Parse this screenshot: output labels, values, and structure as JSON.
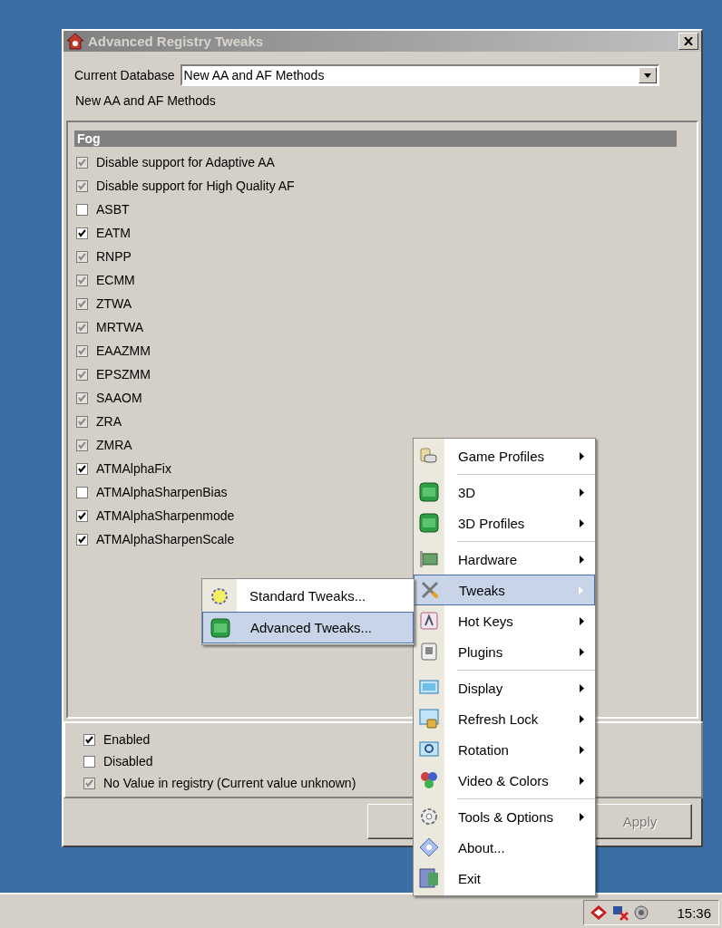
{
  "window": {
    "title": "Advanced Registry Tweaks",
    "database_label": "Current Database",
    "database_value": "New AA and AF Methods",
    "description": "New AA and AF Methods",
    "group": {
      "title": "Fog",
      "options": [
        {
          "label": "Disable support for Adaptive AA",
          "checked": true,
          "grayed": true
        },
        {
          "label": "Disable support for High Quality AF",
          "checked": true,
          "grayed": true
        },
        {
          "label": "ASBT",
          "checked": false,
          "grayed": false
        },
        {
          "label": "EATM",
          "checked": true,
          "grayed": false
        },
        {
          "label": "RNPP",
          "checked": true,
          "grayed": true
        },
        {
          "label": "ECMM",
          "checked": true,
          "grayed": true
        },
        {
          "label": "ZTWA",
          "checked": true,
          "grayed": true
        },
        {
          "label": "MRTWA",
          "checked": true,
          "grayed": true
        },
        {
          "label": "EAAZMM",
          "checked": true,
          "grayed": true
        },
        {
          "label": "EPSZMM",
          "checked": true,
          "grayed": true
        },
        {
          "label": "SAAOM",
          "checked": true,
          "grayed": true
        },
        {
          "label": "ZRA",
          "checked": true,
          "grayed": true
        },
        {
          "label": "ZMRA",
          "checked": true,
          "grayed": true
        },
        {
          "label": "ATMAlphaFix",
          "checked": true,
          "grayed": false
        },
        {
          "label": "ATMAlphaSharpenBias",
          "checked": false,
          "grayed": false
        },
        {
          "label": "ATMAlphaSharpenmode",
          "checked": true,
          "grayed": false
        },
        {
          "label": "ATMAlphaSharpenScale",
          "checked": true,
          "grayed": false
        }
      ]
    },
    "legend": [
      {
        "label": "Enabled",
        "checked": true,
        "grayed": false
      },
      {
        "label": "Disabled",
        "checked": false,
        "grayed": false
      },
      {
        "label": "No Value in registry (Current value unknown)",
        "checked": true,
        "grayed": true
      }
    ],
    "buttons": [
      {
        "label": "Apply",
        "disabled": true
      }
    ]
  },
  "context_menu": {
    "items": [
      {
        "kind": "item",
        "label": "Game Profiles",
        "submenu": true,
        "selected": false
      },
      {
        "kind": "separator"
      },
      {
        "kind": "item",
        "label": "3D",
        "submenu": true,
        "selected": false
      },
      {
        "kind": "item",
        "label": "3D Profiles",
        "submenu": true,
        "selected": false
      },
      {
        "kind": "separator"
      },
      {
        "kind": "item",
        "label": "Hardware",
        "submenu": true,
        "selected": false
      },
      {
        "kind": "item",
        "label": "Tweaks",
        "submenu": true,
        "selected": true
      },
      {
        "kind": "item",
        "label": "Hot Keys",
        "submenu": true,
        "selected": false
      },
      {
        "kind": "item",
        "label": "Plugins",
        "submenu": true,
        "selected": false
      },
      {
        "kind": "separator"
      },
      {
        "kind": "item",
        "label": "Display",
        "submenu": true,
        "selected": false
      },
      {
        "kind": "item",
        "label": "Refresh Lock",
        "submenu": true,
        "selected": false
      },
      {
        "kind": "item",
        "label": "Rotation",
        "submenu": true,
        "selected": false
      },
      {
        "kind": "item",
        "label": "Video & Colors",
        "submenu": true,
        "selected": false
      },
      {
        "kind": "separator"
      },
      {
        "kind": "item",
        "label": "Tools & Options",
        "submenu": true,
        "selected": false
      },
      {
        "kind": "item",
        "label": "About...",
        "submenu": false,
        "selected": false
      },
      {
        "kind": "item",
        "label": "Exit",
        "submenu": false,
        "selected": false
      }
    ]
  },
  "submenu": {
    "items": [
      {
        "label": "Standard Tweaks...",
        "selected": false
      },
      {
        "label": "Advanced Tweaks...",
        "selected": true
      }
    ]
  },
  "taskbar": {
    "clock": "15:36"
  }
}
